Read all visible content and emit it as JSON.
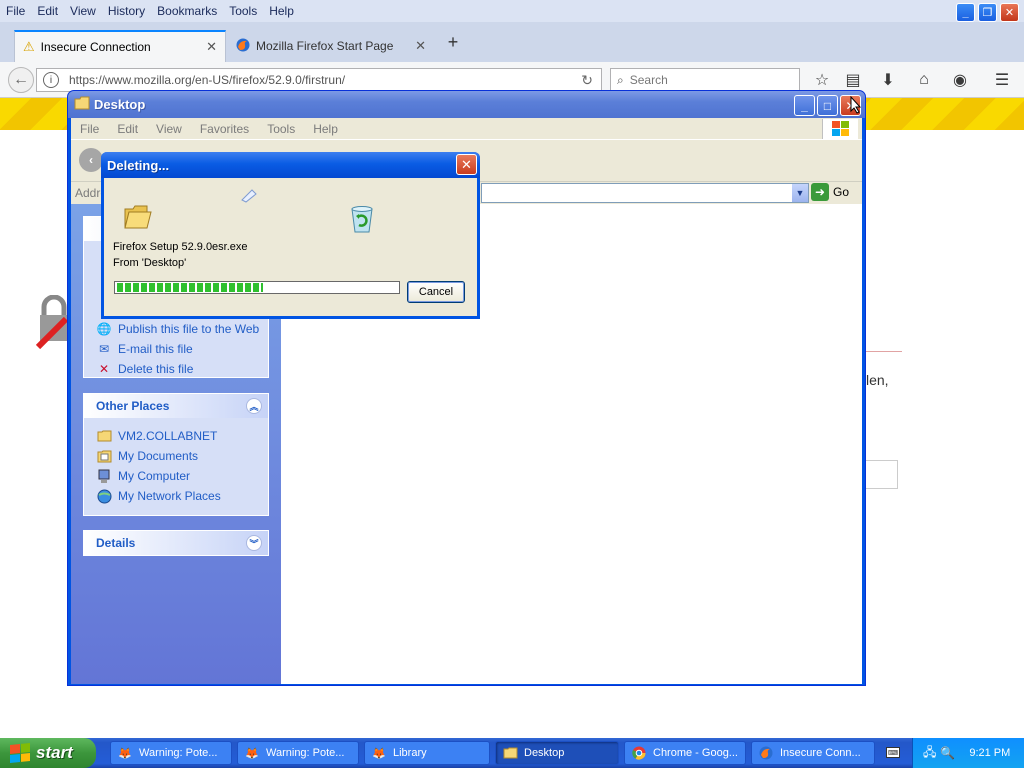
{
  "firefox": {
    "menu": [
      "File",
      "Edit",
      "View",
      "History",
      "Bookmarks",
      "Tools",
      "Help"
    ],
    "tabs": [
      {
        "label": "Insecure Connection",
        "active": true
      },
      {
        "label": "Mozilla Firefox Start Page",
        "active": false
      }
    ],
    "url": "https://www.mozilla.org/en-US/firefox/52.9.0/firstrun/",
    "search_placeholder": "Search",
    "page_fragment_text": "len,"
  },
  "explorer": {
    "title": "Desktop",
    "menu": [
      "File",
      "Edit",
      "View",
      "Favorites",
      "Tools",
      "Help"
    ],
    "address_label": "Addre",
    "go_label": "Go",
    "file_tasks": {
      "items": [
        {
          "label": "Publish this file to the Web",
          "icon": "globe-icon"
        },
        {
          "label": "E-mail this file",
          "icon": "mail-icon"
        },
        {
          "label": "Delete this file",
          "icon": "delete-x-icon"
        }
      ]
    },
    "other_places": {
      "title": "Other Places",
      "items": [
        {
          "label": "VM2.COLLABNET",
          "icon": "folder-icon"
        },
        {
          "label": "My Documents",
          "icon": "documents-icon"
        },
        {
          "label": "My Computer",
          "icon": "computer-icon"
        },
        {
          "label": "My Network Places",
          "icon": "network-icon"
        }
      ]
    },
    "details": {
      "title": "Details"
    }
  },
  "dialog": {
    "title": "Deleting...",
    "filename": "Firefox Setup 52.9.0esr.exe",
    "from": "From 'Desktop'",
    "progress": 0.52,
    "cancel_label": "Cancel"
  },
  "taskbar": {
    "start_label": "start",
    "buttons": [
      {
        "label": "Warning: Pote...",
        "icon": "firefox-icon"
      },
      {
        "label": "Warning: Pote...",
        "icon": "firefox-icon"
      },
      {
        "label": "Library",
        "icon": "firefox-icon"
      },
      {
        "label": "Desktop",
        "icon": "folder-icon"
      },
      {
        "label": "Chrome - Goog...",
        "icon": "chrome-icon"
      },
      {
        "label": "Insecure Conn...",
        "icon": "firefox-icon"
      }
    ],
    "clock": "9:21 PM"
  },
  "colors": {
    "xp_blue": "#0054e3",
    "task_pane_link": "#215dc6",
    "progress_green": "#2fc02f",
    "firefox_yellow": "#f9d900"
  }
}
